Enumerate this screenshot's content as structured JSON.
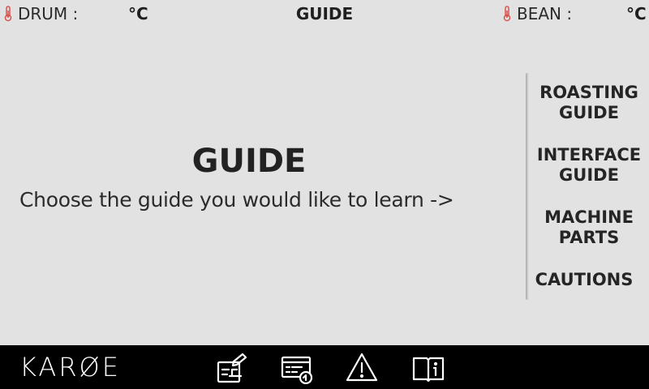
{
  "topbar": {
    "drum_label": "DRUM :",
    "drum_unit": "°C",
    "title": "GUIDE",
    "bean_label": "BEAN :",
    "bean_unit": "°C"
  },
  "main": {
    "title": "GUIDE",
    "subtitle": "Choose the guide you would like to learn ->"
  },
  "menu": {
    "items": [
      {
        "label": "ROASTING\nGUIDE"
      },
      {
        "label": "INTERFACE\nGUIDE"
      },
      {
        "label": "MACHINE\nPARTS"
      },
      {
        "label": "CAUTIONS"
      }
    ]
  },
  "bottombar": {
    "logo": "KARØE",
    "icons": [
      "roast-profile-icon",
      "recipe-card-icon",
      "warning-icon",
      "guide-book-icon"
    ]
  },
  "colors": {
    "background": "#e2e2e2",
    "thermometer": "#d9534f",
    "bottom_bar": "#000000",
    "text": "#2b2b2b"
  }
}
